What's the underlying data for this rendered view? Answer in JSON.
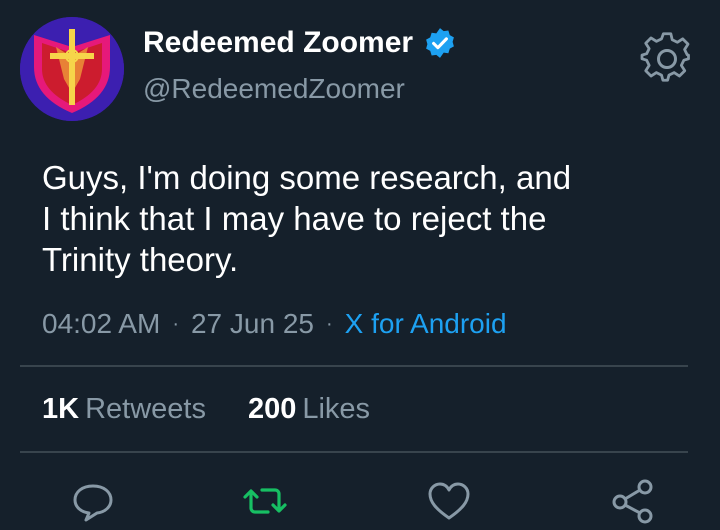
{
  "tweet": {
    "display_name": "Redeemed Zoomer",
    "handle": "@RedeemedZoomer",
    "verified": true,
    "text_lines": [
      "Guys, I'm doing some research, and",
      "I think that I may have to reject the",
      "Trinity theory."
    ],
    "time": "04:02 AM",
    "date": "27 Jun 25",
    "source": "X for Android",
    "meta_separator": "·"
  },
  "stats": {
    "retweets_count": "1K",
    "retweets_label": "Retweets",
    "likes_count": "200",
    "likes_label": "Likes"
  },
  "icons": {
    "settings": "gear-icon",
    "verified": "verified-badge-icon",
    "reply": "reply-icon",
    "retweet": "retweet-icon",
    "like": "heart-icon",
    "share": "share-icon"
  },
  "colors": {
    "background": "#15202b",
    "text_primary": "#ffffff",
    "text_secondary": "#8899a6",
    "link": "#1da1f2",
    "retweet_active": "#17bf63",
    "divider": "#38444d"
  }
}
